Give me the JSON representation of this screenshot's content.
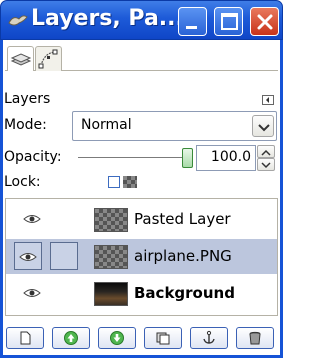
{
  "window": {
    "title": "Layers, Pa...",
    "icons": {
      "app": "gimp-wilber-icon",
      "minimize": "minimize-icon",
      "maximize": "maximize-icon",
      "close": "close-icon"
    },
    "colors": {
      "titlebar": "#1d5ad8",
      "close": "#c8331a",
      "selection": "#bcc6dd"
    }
  },
  "tabs": [
    {
      "icon": "layers-tab-icon"
    },
    {
      "icon": "paths-tab-icon"
    }
  ],
  "panel": {
    "header": "Layers",
    "mode_label": "Mode:",
    "mode_value": "Normal",
    "opacity_label": "Opacity:",
    "opacity_value": "100.0",
    "opacity_level_percent": 100,
    "lock_label": "Lock:"
  },
  "layers": [
    {
      "name": "Pasted Layer",
      "visible": true,
      "selected": false,
      "bold": false,
      "thumbnail": "transparent-checker"
    },
    {
      "name": "airplane.PNG",
      "visible": true,
      "selected": true,
      "bold": false,
      "thumbnail": "transparent-checker"
    },
    {
      "name": "Background",
      "visible": true,
      "selected": false,
      "bold": true,
      "thumbnail": "photo"
    }
  ],
  "toolbar": [
    {
      "icon": "new-layer-icon"
    },
    {
      "icon": "raise-layer-icon"
    },
    {
      "icon": "lower-layer-icon"
    },
    {
      "icon": "duplicate-layer-icon"
    },
    {
      "icon": "anchor-layer-icon"
    },
    {
      "icon": "delete-layer-icon"
    }
  ]
}
